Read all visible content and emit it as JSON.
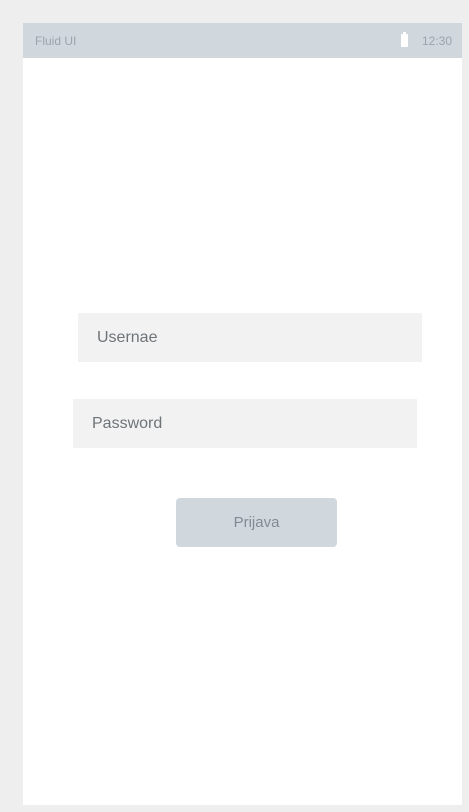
{
  "status_bar": {
    "app_name": "Fluid UI",
    "time": "12:30",
    "icons": {
      "battery": "battery-icon"
    }
  },
  "login_form": {
    "username_placeholder": "Usernae",
    "password_placeholder": "Password",
    "submit_label": "Prijava"
  },
  "colors": {
    "background": "#eeeeee",
    "screen": "#ffffff",
    "status_bar": "#d0d8de",
    "field_background": "#f2f2f2",
    "button_background": "#d0d8de",
    "text": "#6f7478"
  }
}
